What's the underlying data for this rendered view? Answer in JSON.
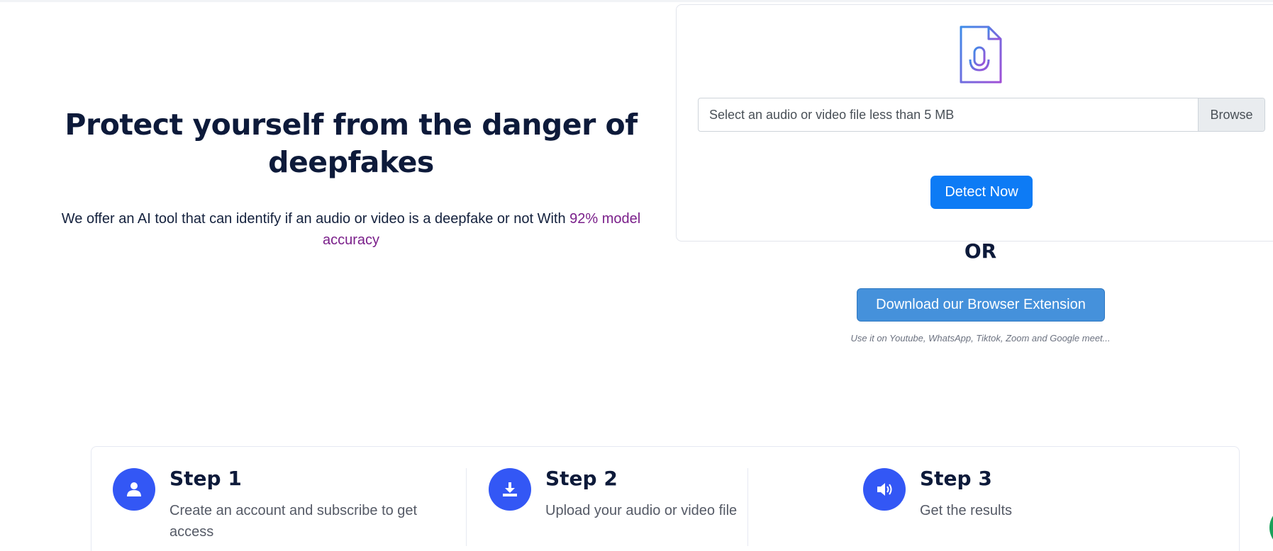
{
  "hero": {
    "title": "Protect yourself from the danger of deepfakes",
    "subtitle_text": "We offer an AI tool that can identify if an audio or video is a deepfake or not With ",
    "subtitle_accent": "92% model accuracy"
  },
  "upload": {
    "icon": "audio-file-icon",
    "file_placeholder": "Select an audio or video file less than 5 MB",
    "browse_label": "Browse",
    "detect_label": "Detect Now"
  },
  "alternative": {
    "or_label": "OR",
    "extension_button_label": "Download our Browser Extension",
    "extension_note": "Use it on Youtube, WhatsApp, Tiktok, Zoom and Google meet..."
  },
  "steps": [
    {
      "title": "Step 1",
      "description": "Create an account and subscribe to get access",
      "icon": "user-icon"
    },
    {
      "title": "Step 2",
      "description": "Upload your audio or video file",
      "icon": "download-icon"
    },
    {
      "title": "Step 3",
      "description": "Get the results",
      "icon": "speaker-icon"
    }
  ],
  "colors": {
    "primary": "#0d7bf5",
    "extension": "#4591db",
    "step_icon_bg": "#3357f5",
    "accent_text": "#7a1f8a",
    "heading": "#0d1a3a"
  }
}
